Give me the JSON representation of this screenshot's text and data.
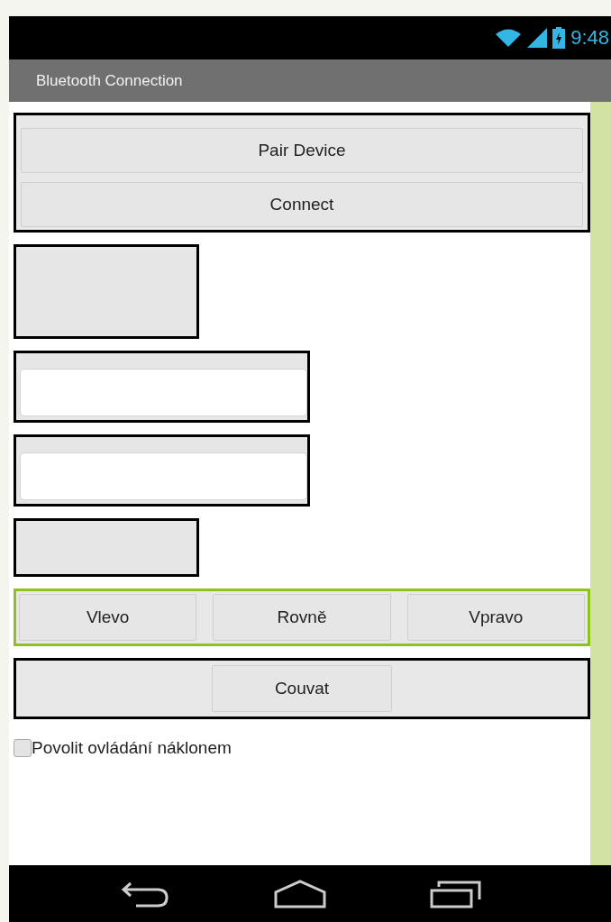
{
  "status_bar": {
    "time": "9:48"
  },
  "title_bar": {
    "title": "Bluetooth Connection"
  },
  "components": [
    {
      "kind": "column",
      "selected": false,
      "buttons": [
        "Pair Device",
        "Connect"
      ]
    },
    {
      "kind": "label"
    },
    {
      "kind": "textbox"
    },
    {
      "kind": "textbox"
    },
    {
      "kind": "shortlabel"
    },
    {
      "kind": "row",
      "selected": true,
      "buttons": [
        "Vlevo",
        "Rovně",
        "Vpravo"
      ]
    },
    {
      "kind": "centered",
      "selected": false,
      "buttons": [
        "Couvat"
      ]
    },
    {
      "kind": "checkbox",
      "label": "Povolit ovládání náklonem",
      "checked": false
    }
  ]
}
